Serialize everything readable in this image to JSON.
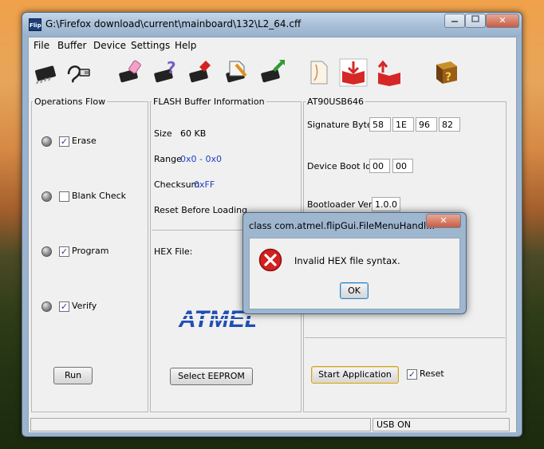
{
  "window": {
    "title": "G:\\Firefox download\\current\\mainboard\\132\\L2_64.cff",
    "app_icon": "Flip",
    "minimize_icon": "minimize-icon",
    "maximize_icon": "maximize-icon",
    "close_glyph": "✕"
  },
  "menu": [
    "File",
    "Buffer",
    "Device",
    "Settings",
    "Help"
  ],
  "toolbar": [
    "select-device-icon",
    "communication-usb-icon",
    "erase-icon",
    "blank-check-icon",
    "program-icon",
    "load-hex-icon",
    "verify-icon",
    "open-document-icon",
    "read-book-icon",
    "load-book-icon",
    "help-book-icon"
  ],
  "operations": {
    "label": "Operations Flow",
    "items": [
      {
        "label": "Erase",
        "checked": true
      },
      {
        "label": "Blank Check",
        "checked": false
      },
      {
        "label": "Program",
        "checked": true
      },
      {
        "label": "Verify",
        "checked": true
      }
    ],
    "run_label": "Run"
  },
  "buffer": {
    "label": "FLASH Buffer Information",
    "size_label": "Size",
    "size_value": "60 KB",
    "range_label": "Range",
    "range_value": "0x0 - 0x0",
    "checksum_label": "Checksum",
    "checksum_value": "0xFF",
    "reset_label": "Reset Before Loading",
    "hex_label": "HEX File:",
    "logo_text": "ATMEL",
    "select_eeprom_label": "Select EEPROM"
  },
  "device": {
    "label": "AT90USB646",
    "signature_label": "Signature Bytes",
    "signature": [
      "58",
      "1E",
      "96",
      "82"
    ],
    "boot_ids_label": "Device Boot Ids",
    "boot_ids": [
      "00",
      "00"
    ],
    "bootloader_label": "Bootloader Ver.",
    "bootloader_value": "1.0.0",
    "start_app_label": "Start Application",
    "reset_label": "Reset",
    "reset_checked": true
  },
  "status": {
    "left": "",
    "right": "USB ON"
  },
  "dialog": {
    "title": "class com.atmel.flipGui.FileMenuHandl...",
    "close_glyph": "✕",
    "message": "Invalid HEX file syntax.",
    "ok_label": "OK"
  },
  "colors": {
    "accent_blue": "#1e3fc8",
    "error_red": "#d32020"
  }
}
